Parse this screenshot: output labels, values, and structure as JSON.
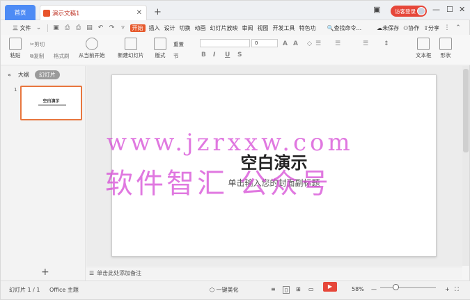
{
  "titlebar": {
    "home_tab": "首页",
    "doc_tab": "演示文稿1",
    "login_label": "访客登录"
  },
  "menubar": {
    "file": "三 文件",
    "items": [
      "开始",
      "插入",
      "设计",
      "切换",
      "动画",
      "幻灯片放映",
      "审阅",
      "视图",
      "开发工具",
      "特色功"
    ],
    "active": "开始",
    "search": "查找命令...",
    "unsaved": "未保存",
    "collab": "协作",
    "share": "分享"
  },
  "ribbon": {
    "paste": "粘贴",
    "cut": "剪切",
    "copy": "复制",
    "format_painter": "格式刷",
    "from_current": "从当前开始",
    "new_slide": "新建幻灯片",
    "layout": "版式",
    "reset": "重置",
    "section": "节",
    "font_size": "0",
    "textbox": "文本框",
    "shape": "形状"
  },
  "left_panel": {
    "outline_tab": "大纲",
    "slides_tab": "幻灯片",
    "thumb_title": "空白演示",
    "slide_number": "1"
  },
  "slide": {
    "title": "空白演示",
    "subtitle": "单击输入您的封面副标题"
  },
  "notes": {
    "placeholder": "单击此处添加备注"
  },
  "watermark": {
    "line1": "www.jzrxxw.com",
    "line2": "软件智汇 公众号"
  },
  "statusbar": {
    "slide_info": "幻灯片 1 / 1",
    "theme": "Office 主题",
    "beautify": "一键美化",
    "zoom": "58%"
  },
  "colors": {
    "accent": "#e65a2d",
    "home_tab": "#4d8bf5",
    "login": "#e6473a",
    "watermark": "#d64bd6"
  }
}
